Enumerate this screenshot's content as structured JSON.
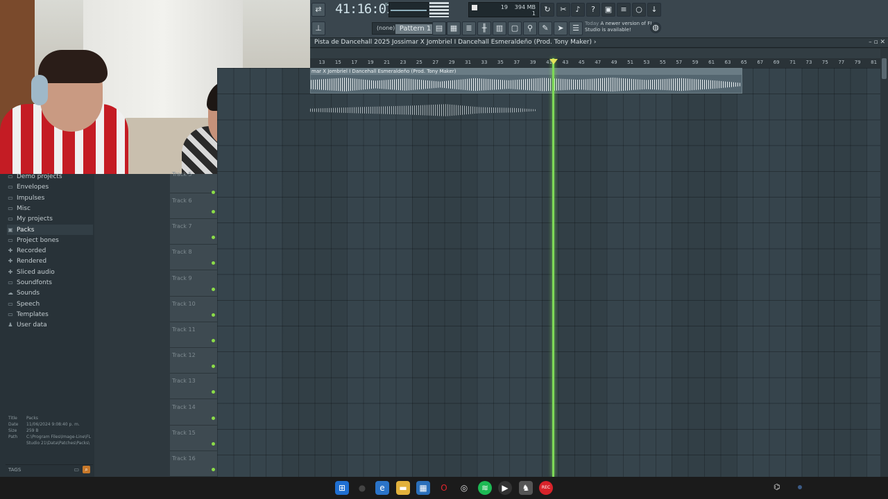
{
  "webcam": {
    "label": "webcam-overlay"
  },
  "toolbar": {
    "time": "41:16:01",
    "time_small": "B:S:T",
    "cpu": "19",
    "mem": "394 MB",
    "poly": "1",
    "pattern_none": "(none)",
    "pattern_name": "Pattern 1",
    "news_today": "Today",
    "news_text": "A newer version of FL Studio is available!"
  },
  "playlist": {
    "title": "Pista de Dancehall 2025 Jossimar X Jombriel I Dancehall Esmeraldeño (Prod. Tony Maker) ›",
    "controls": "– ▫ ✕",
    "ruler": [
      "13",
      "15",
      "17",
      "19",
      "21",
      "23",
      "25",
      "27",
      "29",
      "31",
      "33",
      "35",
      "37",
      "39",
      "41",
      "43",
      "45",
      "47",
      "49",
      "51",
      "53",
      "55",
      "57",
      "59",
      "61",
      "63",
      "65",
      "67",
      "69",
      "71",
      "73",
      "75",
      "77",
      "79",
      "81"
    ],
    "clip1_label": "mar X Jombriel I Dancehall Esmeraldeño (Prod. Tony Maker)",
    "tracks": [
      "Track 6",
      "Track 7",
      "Track 8",
      "Track 9",
      "Track 10",
      "Track 11",
      "Track 12",
      "Track 13",
      "Track 14",
      "Track 15",
      "Track 16"
    ],
    "partial_track": "Track 5"
  },
  "browser": {
    "items": [
      {
        "label": "Demo projects",
        "icon": "folder-icon"
      },
      {
        "label": "Envelopes",
        "icon": "folder-icon"
      },
      {
        "label": "Impulses",
        "icon": "folder-icon"
      },
      {
        "label": "Misc",
        "icon": "folder-icon"
      },
      {
        "label": "My projects",
        "icon": "folder-icon"
      },
      {
        "label": "Packs",
        "icon": "packs-icon"
      },
      {
        "label": "Project bones",
        "icon": "folder-icon"
      },
      {
        "label": "Recorded",
        "icon": "plus-icon"
      },
      {
        "label": "Rendered",
        "icon": "plus-icon"
      },
      {
        "label": "Sliced audio",
        "icon": "plus-icon"
      },
      {
        "label": "Soundfonts",
        "icon": "folder-icon"
      },
      {
        "label": "Sounds",
        "icon": "cloud-icon"
      },
      {
        "label": "Speech",
        "icon": "folder-icon"
      },
      {
        "label": "Templates",
        "icon": "folder-icon"
      },
      {
        "label": "User data",
        "icon": "user-icon"
      }
    ],
    "selected": "Packs",
    "info": {
      "title_k": "Title",
      "title_v": "Packs",
      "date_k": "Date",
      "date_v": "11/06/2024 9:08:40 p. m.",
      "size_k": "Size",
      "size_v": "259 B",
      "path_k": "Path",
      "path_v": "C:\\Program Files\\Image-Line\\FL Studio 21\\Data\\Patches\\Packs\\"
    },
    "tags": "TAGS"
  },
  "colors": {
    "playhead": "#7ed957",
    "accent": "#c7782a"
  }
}
